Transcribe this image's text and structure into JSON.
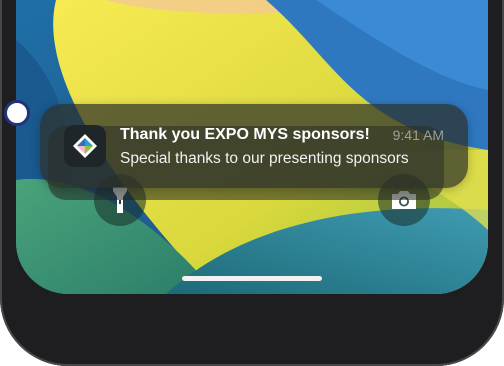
{
  "notification": {
    "app_icon": "expo-app-icon",
    "title": "Thank you EXPO MYS sponsors!",
    "time": "9:41 AM",
    "body": "Special thanks to our presenting sponsors"
  },
  "lock_screen": {
    "left_button_icon": "flashlight-icon",
    "right_button_icon": "camera-icon"
  },
  "colors": {
    "callout_ring": "#23337a",
    "notification_bg": "#2d302a",
    "wallpaper_yellow": "#f2e24a",
    "wallpaper_blue": "#2b5f86"
  }
}
